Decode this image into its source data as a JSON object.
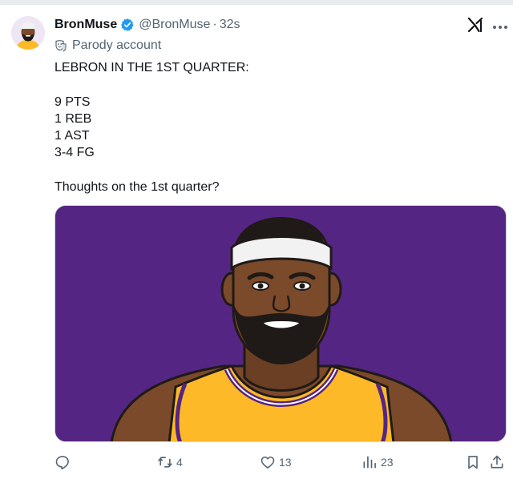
{
  "tweet": {
    "author": {
      "display_name": "BronMuse",
      "handle": "@BronMuse",
      "verified": true,
      "avatar_icon": "cartoon-avatar-icon"
    },
    "separator": "·",
    "time": "32s",
    "parody_label": "Parody account",
    "text_lines": [
      "LEBRON IN THE 1ST QUARTER:",
      "",
      "9 PTS",
      "1 REB",
      "1 AST",
      "3-4 FG",
      "",
      "Thoughts on the 1st quarter?"
    ],
    "media": {
      "type": "illustration",
      "background_color": "#552583",
      "jersey_color": "#fdb927",
      "headband_color": "#f2f2f2"
    },
    "actions": {
      "reply": {
        "icon": "reply-icon",
        "count": ""
      },
      "retweet": {
        "icon": "retweet-icon",
        "count": "4"
      },
      "like": {
        "icon": "heart-icon",
        "count": "13"
      },
      "views": {
        "icon": "analytics-icon",
        "count": "23"
      },
      "bookmark": {
        "icon": "bookmark-icon"
      },
      "share": {
        "icon": "share-icon"
      }
    }
  },
  "colors": {
    "text": "#0f1419",
    "secondary_text": "#536471",
    "verified_blue": "#1d9bf0"
  }
}
